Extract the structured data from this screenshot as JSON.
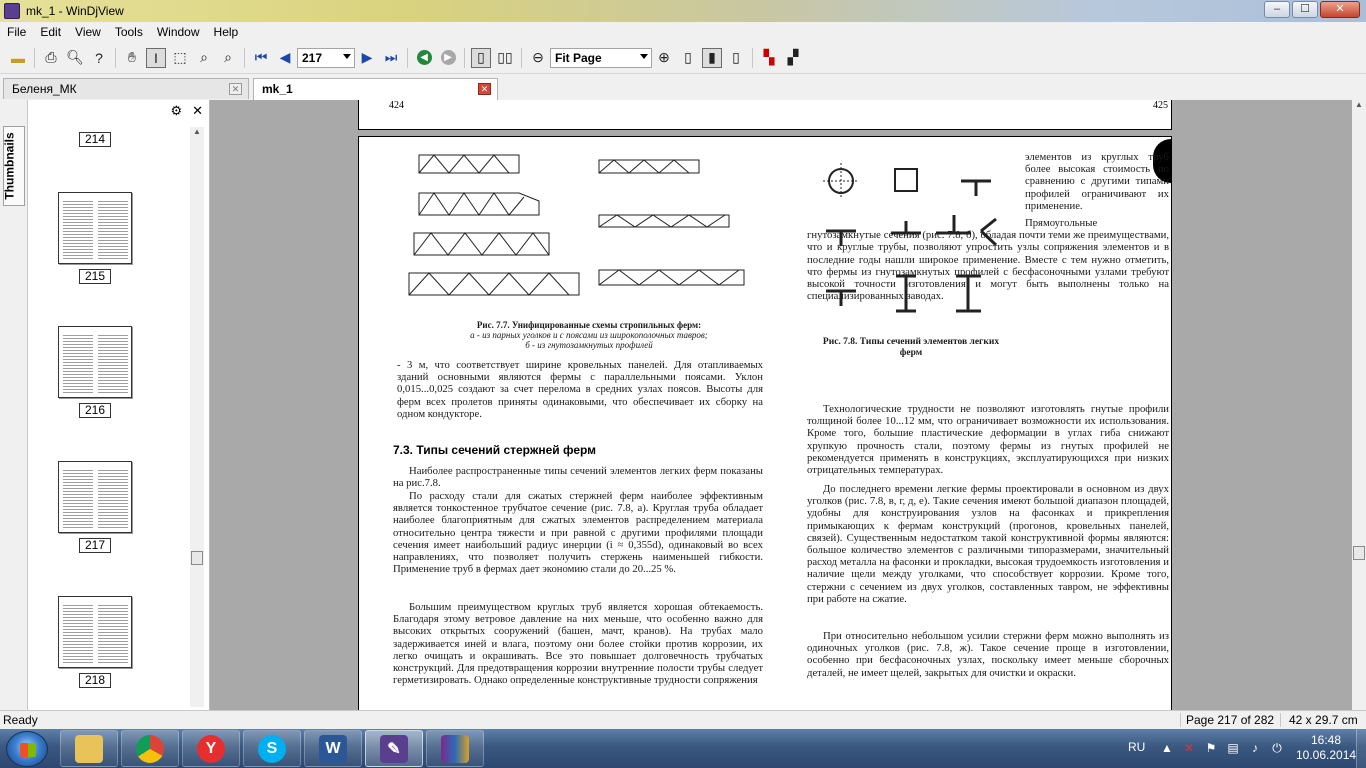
{
  "window": {
    "title": "mk_1 - WinDjView",
    "controls": {
      "minimize": "–",
      "maximize": "☐",
      "close": "✕"
    }
  },
  "menu": [
    "File",
    "Edit",
    "View",
    "Tools",
    "Window",
    "Help"
  ],
  "toolbar": {
    "page_number": "217",
    "zoom": "Fit Page"
  },
  "tabs": [
    {
      "label": "Беленя_МК",
      "active": false
    },
    {
      "label": "mk_1",
      "active": true
    }
  ],
  "sidebar": {
    "tab_label": "Thumbnails",
    "thumbnails": [
      "214",
      "215",
      "216",
      "217",
      "218"
    ]
  },
  "document": {
    "prev_page_left_number": "424",
    "prev_page_right_number": "425",
    "left_col_text_1": "- 3 м, что соответствует ширине кровельных панелей. Для отапливаемых зданий основными являются фермы с параллельными поясами. Уклон 0,015...0,025 создают за счет перелома в средних узлах поясов. Высоты для ферм всех пролетов приняты одинаковыми, что обеспечивает их сборку на одном кондукторе.",
    "section_heading": "7.3. Типы сечений стержней ферм",
    "left_col_text_2": "Наиболее распространенные типы сечений элементов легких ферм показаны на рис.7.8.",
    "left_col_text_3": "По расходу стали для сжатых стержней ферм наиболее эффективным является тонкостенное трубчатое сечение (рис. 7.8, а). Круглая труба обладает наиболее благоприятным для сжатых элементов распределением материала относительно центра тяжести и при равной с другими профилями площади сечения имеет наибольший радиус инерции (i ≈ 0,355d), одинаковый во всех направлениях, что позволяет получить стержень наименьшей гибкости. Применение труб в фермах дает экономию стали до 20...25 %.",
    "left_col_text_4": "Большим преимуществом круглых труб является хорошая обтекаемость. Благодаря этому ветровое давление на них меньше, что особенно важно для высоких открытых сооружений (башен, мачт, кранов). На трубах мало задерживается иней и влага, поэтому они более стойки против коррозии, их легко очищать и окрашивать. Все это повышает долговечность трубчатых конструкций. Для предотвращения коррозии внутренние полости трубы следует герметизировать. Однако определенные конструктивные трудности сопряжения",
    "fig77_title": "Рис. 7.7. Унифицированные схемы стропильных ферм:",
    "fig77_a": "а - из парных уголков и с поясами из широкополочных тавров;",
    "fig77_b": "б - из гнутозамкнутых профилей",
    "fig78_title": "Рис. 7.8. Типы сечений элементов легких ферм",
    "right_col_text_1": "элементов из круглых труб более высокая стоимость по сравнению с другими типами профилей ограничивают их применение.",
    "right_col_text_2": "Прямоугольные гнутозамкнутые сечения (рис. 7.8, б), обладая почти теми же преимуществами, что и круглые трубы, позволяют упростить узлы сопряжения элементов и в последние годы нашли широкое применение. Вместе с тем нужно отметить, что фермы из гнутозамкнутых профилей с бесфасоночными узлами требуют высокой точности изготовления и могут быть выполнены только на специализированных заводах.",
    "right_col_text_3": "Технологические трудности не позволяют изготовлять гнутые профили толщиной более 10...12 мм, что ограничивает возможности их использования. Кроме того, большие пластические деформации в углах гиба снижают хрупкую прочность стали, поэтому фермы из гнутых профилей не рекомендуется применять в конструкциях, эксплуатирующихся при низких отрицательных температурах.",
    "right_col_text_4": "До последнего времени легкие фермы проектировали в основном из двух уголков (рис. 7.8, в, г, д, е). Такие сечения имеют большой диапазон площадей, удобны для конструирования узлов на фасонках и прикрепления примыкающих к фермам конструкций (прогонов, кровельных панелей, связей). Существенным недостатком такой конструктивной формы являются: большое количество элементов с различными типоразмерами, значительный расход металла на фасонки и прокладки, высокая трудоемкость изготовления и наличие щели между уголками, что способствует коррозии. Кроме того, стержни с сечением из двух уголков, составленных тавром, не эффективны при работе на сжатие.",
    "right_col_text_5": "При относительно небольшом усилии стержни ферм можно выполнять из одиночных уголков (рис. 7.8, ж). Такое сечение проще в изготовлении, особенно при бесфасоночных узлах, поскольку имеет меньше сборочных деталей, не имеет щелей, закрытых для очистки и окраски."
  },
  "status": {
    "ready": "Ready",
    "page": "Page 217 of 282",
    "size": "42 x 29.7 cm"
  },
  "taskbar": {
    "language": "RU",
    "time": "16:48",
    "date": "10.06.2014"
  }
}
